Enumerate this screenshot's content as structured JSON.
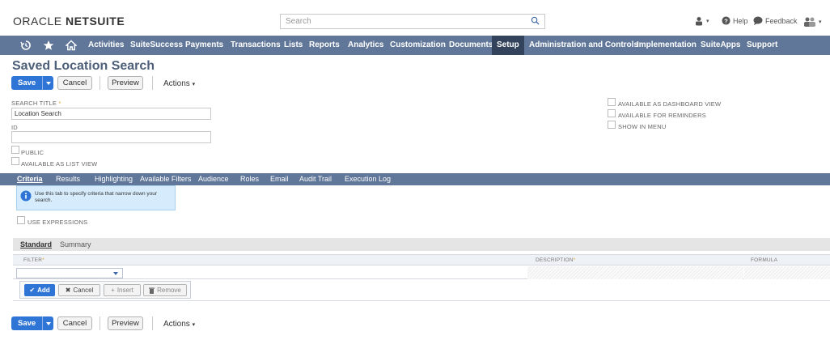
{
  "header": {
    "logo_prefix": "ORACLE",
    "logo_suffix": "NETSUITE",
    "search_placeholder": "Search",
    "help": "Help",
    "feedback": "Feedback"
  },
  "nav": {
    "items": [
      "Activities",
      "SuiteSuccess",
      "Payments",
      "Transactions",
      "Lists",
      "Reports",
      "Analytics",
      "Customization",
      "Documents",
      "Setup",
      "Administration and Controls",
      "Implementation",
      "SuiteApps",
      "Support"
    ],
    "active": "Setup"
  },
  "page": {
    "title": "Saved Location Search"
  },
  "toolbar": {
    "save": "Save",
    "cancel": "Cancel",
    "preview": "Preview",
    "actions": "Actions"
  },
  "form": {
    "search_title_label": "SEARCH TITLE",
    "search_title_value": "Location Search",
    "id_label": "ID",
    "id_value": "",
    "public_label": "PUBLIC",
    "list_view_label": "AVAILABLE AS LIST VIEW",
    "dashboard_label": "AVAILABLE AS DASHBOARD VIEW",
    "reminders_label": "AVAILABLE FOR REMINDERS",
    "menu_label": "SHOW IN MENU"
  },
  "subtabs": [
    "Criteria",
    "Results",
    "Highlighting",
    "Available Filters",
    "Audience",
    "Roles",
    "Email",
    "Audit Trail",
    "Execution Log"
  ],
  "help_text": "Use this tab to specify criteria that narrow down your search.",
  "use_expressions_label": "USE EXPRESSIONS",
  "criteria": {
    "tabs": [
      "Standard",
      "Summary"
    ],
    "columns": [
      "FILTER",
      "DESCRIPTION",
      "FORMULA"
    ],
    "buttons": {
      "add": "Add",
      "cancel": "Cancel",
      "insert": "Insert",
      "remove": "Remove"
    }
  },
  "colors": {
    "nav": "#607799",
    "nav_active": "#34435c",
    "primary": "#2f75d6",
    "title": "#4d5f79"
  }
}
